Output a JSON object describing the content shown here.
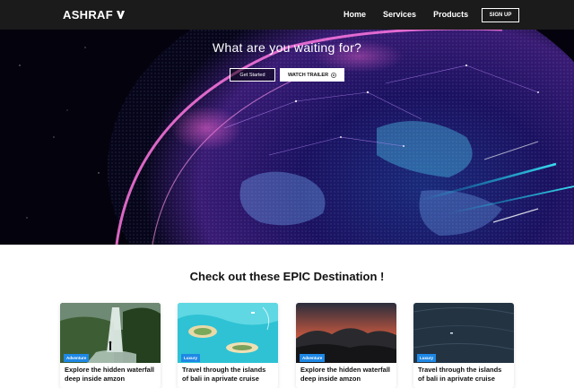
{
  "nav": {
    "logo": "ASHRAF",
    "links": [
      "Home",
      "Services",
      "Products"
    ],
    "signup": "SIGN UP"
  },
  "hero": {
    "title": "What are you waiting for?",
    "get_started": "Get Started",
    "watch_trailer": "WATCH TRAILER"
  },
  "section": {
    "title": "Check out these EPIC Destination !"
  },
  "cards": [
    {
      "badge": "Adventure",
      "text": "Explore the hidden waterfall deep inside amzon"
    },
    {
      "badge": "Luxury",
      "text": "Travel through the islands of bali in aprivate cruise"
    },
    {
      "badge": "Adventure",
      "text": "Explore the hidden waterfall deep inside amzon"
    },
    {
      "badge": "Luxury",
      "text": "Travel through the islands of bali in aprivate cruise"
    }
  ],
  "colors": {
    "navbar": "#1b1b1b",
    "badge": "#1e88e5"
  }
}
